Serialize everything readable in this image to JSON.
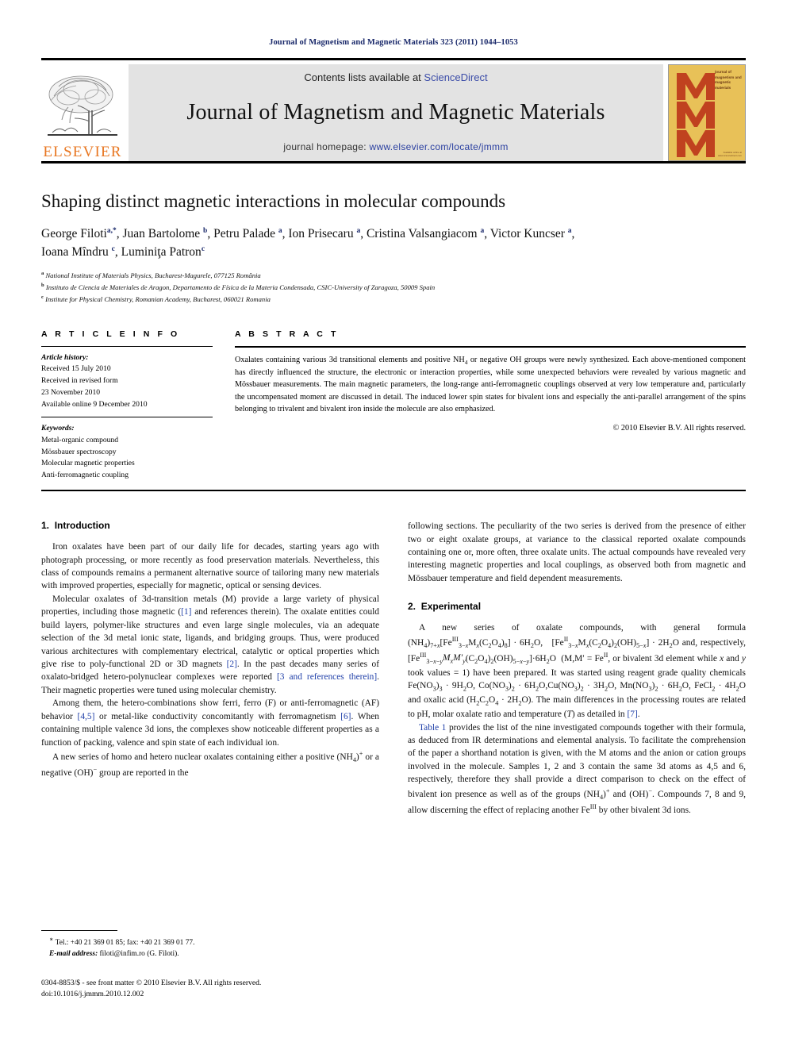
{
  "running_head": "Journal of Magnetism and Magnetic Materials 323 (2011) 1044–1053",
  "masthead": {
    "publisher_wordmark": "ELSEVIER",
    "contents_prefix": "Contents lists available at ",
    "contents_link": "ScienceDirect",
    "journal_title": "Journal of Magnetism and Magnetic Materials",
    "homepage_prefix": "journal homepage: ",
    "homepage_url": "www.elsevier.com/locate/jmmm",
    "cover": {
      "caption": "journal of magnetism and magnetic materials",
      "footer": "Available online at www.sciencedirect.com",
      "bg_color": "#e8c158",
      "letter_color": "#c0421f",
      "letters": "MMM"
    }
  },
  "article": {
    "title": "Shaping distinct magnetic interactions in molecular compounds",
    "authors": [
      {
        "name": "George Filoti",
        "marks": "a,*"
      },
      {
        "name": "Juan Bartolome",
        "marks": "b"
      },
      {
        "name": "Petru Palade",
        "marks": "a"
      },
      {
        "name": "Ion Prisecaru",
        "marks": "a"
      },
      {
        "name": "Cristina Valsangiacom",
        "marks": "a"
      },
      {
        "name": "Victor Kuncser",
        "marks": "a"
      },
      {
        "name": "Ioana Mîndru",
        "marks": "c"
      },
      {
        "name": "Luminiţa Patron",
        "marks": "c"
      }
    ],
    "affiliations": [
      {
        "mark": "a",
        "text": "National Institute of Materials Physics, Bucharest-Magurele, 077125 România"
      },
      {
        "mark": "b",
        "text": "Instituto de Ciencia de Materiales de Aragon, Departamento de Física de la Materia Condensada, CSIC-University of Zaragoza, 50009 Spain"
      },
      {
        "mark": "c",
        "text": "Institute for Physical Chemistry, Romanian Academy, Bucharest, 060021 Romania"
      }
    ]
  },
  "article_info": {
    "heading": "A R T I C L E   I N F O",
    "history_label": "Article history:",
    "history": [
      "Received 15 July 2010",
      "Received in revised form",
      "23 November 2010",
      "Available online 9 December 2010"
    ],
    "keywords_label": "Keywords:",
    "keywords": [
      "Metal-organic compound",
      "Mössbauer spectroscopy",
      "Molecular magnetic properties",
      "Anti-ferromagnetic coupling"
    ]
  },
  "abstract": {
    "heading": "A B S T R A C T",
    "text": "Oxalates containing various 3d transitional elements and positive NH4 or negative OH groups were newly synthesized. Each above-mentioned component has directly influenced the structure, the electronic or interaction properties, while some unexpected behaviors were revealed by various magnetic and Mössbauer measurements. The main magnetic parameters, the long-range anti-ferromagnetic couplings observed at very low temperature and, particularly the uncompensated moment are discussed in detail. The induced lower spin states for bivalent ions and especially the anti-parallel arrangement of the spins belonging to trivalent and bivalent iron inside the molecule are also emphasized.",
    "copyright": "© 2010 Elsevier B.V. All rights reserved."
  },
  "sections": {
    "introduction": {
      "number": "1.",
      "title": "Introduction",
      "paragraphs": [
        "Iron oxalates have been part of our daily life for decades, starting years ago with photograph processing, or more recently as food preservation materials. Nevertheless, this class of compounds remains a permanent alternative source of tailoring many new materials with improved properties, especially for magnetic, optical or sensing devices.",
        "Molecular oxalates of 3d-transition metals (M) provide a large variety of physical properties, including those magnetic ([1] and references therein). The oxalate entities could build layers, polymer-like structures and even large single molecules, via an adequate selection of the 3d metal ionic state, ligands, and bridging groups. Thus, were produced various architectures with complementary electrical, catalytic or optical properties which give rise to poly-functional 2D or 3D magnets [2]. In the past decades many series of oxalato-bridged hetero-polynuclear complexes were reported [3 and references therein]. Their magnetic properties were tuned using molecular chemistry.",
        "Among them, the hetero-combinations show ferri, ferro (F) or anti-ferromagnetic (AF) behavior [4,5] or metal-like conductivity concomitantly with ferromagnetism [6]. When containing multiple valence 3d ions, the complexes show noticeable different properties as a function of packing, valence and spin state of each individual ion.",
        "A new series of homo and hetero nuclear oxalates containing either a positive (NH4)+ or a negative (OH)− group are reported in the following sections. The peculiarity of the two series is derived from the presence of either two or eight oxalate groups, at variance to the classical reported oxalate compounds containing one or, more often, three oxalate units. The actual compounds have revealed very interesting magnetic properties and local couplings, as observed both from magnetic and Mössbauer temperature and field dependent measurements."
      ]
    },
    "experimental": {
      "number": "2.",
      "title": "Experimental",
      "paragraph_2": "Table 1 provides the list of the nine investigated compounds together with their formula, as deduced from IR determinations and elemental analysis. To facilitate the comprehension of the paper a shorthand notation is given, with the M atoms and the anion or cation groups involved in the molecule. Samples 1, 2 and 3 contain the same 3d atoms as 4,5 and 6, respectively, therefore they shall provide a direct comparison to check on the effect of bivalent ion presence as well as of the groups (NH4)+ and (OH)−. Compounds 7, 8 and 9, allow discerning the effect of replacing another FeIII by other bivalent 3d ions."
    }
  },
  "footnote": {
    "contact": "Tel.: +40 21 369 01 85; fax: +40 21 369 01 77.",
    "email_label": "E-mail address:",
    "email": "filoti@infim.ro (G. Filoti).",
    "imprint_line1": "0304-8853/$ - see front matter © 2010 Elsevier B.V. All rights reserved.",
    "imprint_line2": "doi:10.1016/j.jmmm.2010.12.002"
  },
  "colors": {
    "link_blue": "#1f3fa8",
    "runhead_blue": "#1b2a6b",
    "elsevier_orange": "#e87722",
    "banner_gray": "#e3e3e3"
  }
}
